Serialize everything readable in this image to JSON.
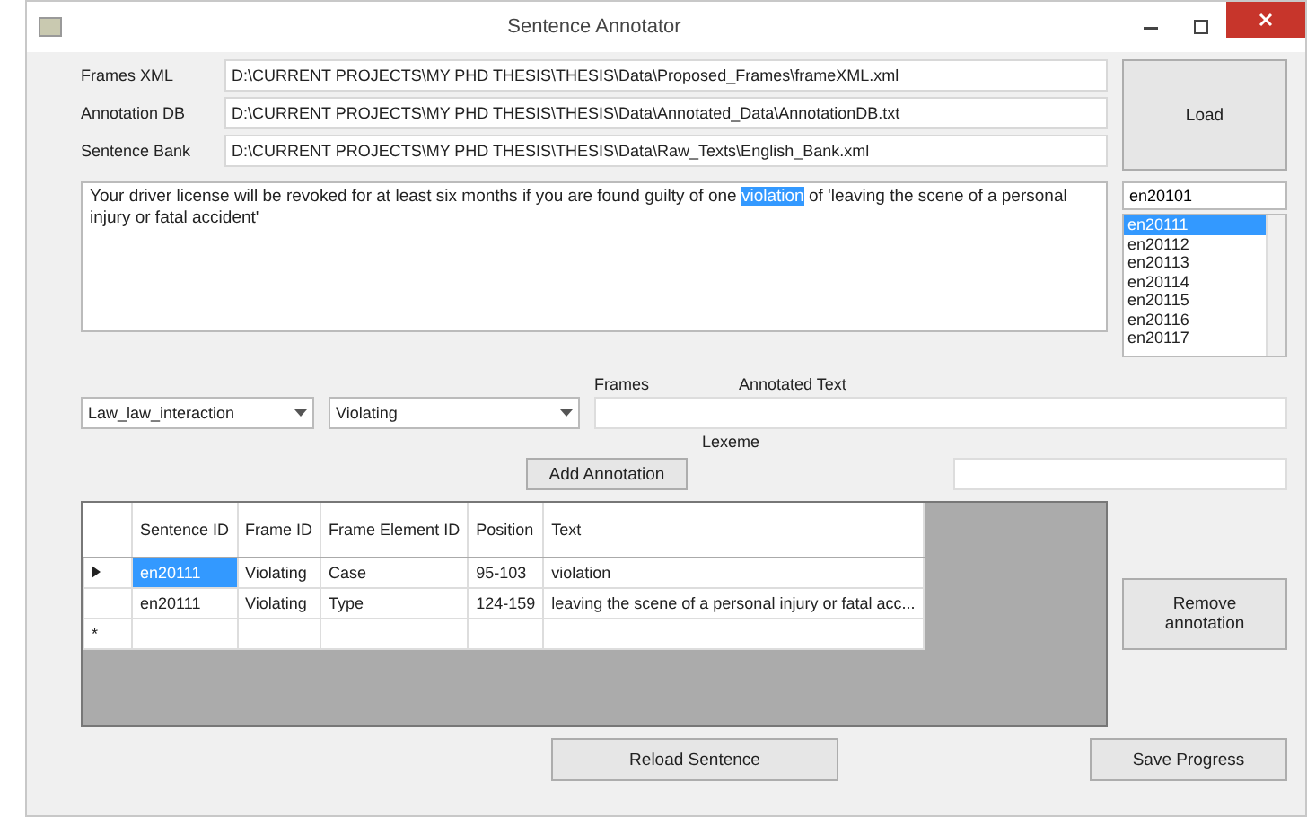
{
  "window": {
    "title": "Sentence Annotator"
  },
  "paths": [
    {
      "label": "Frames XML",
      "value": "D:\\CURRENT PROJECTS\\MY PHD THESIS\\THESIS\\Data\\Proposed_Frames\\frameXML.xml"
    },
    {
      "label": "Annotation DB",
      "value": "D:\\CURRENT PROJECTS\\MY PHD THESIS\\THESIS\\Data\\Annotated_Data\\AnnotationDB.txt"
    },
    {
      "label": "Sentence Bank",
      "value": "D:\\CURRENT PROJECTS\\MY PHD THESIS\\THESIS\\Data\\Raw_Texts\\English_Bank.xml"
    }
  ],
  "load_button": "Load",
  "sentence": [
    {
      "text": "Your driver license will be revoked for at least six months if you are found guilty of one ",
      "selected": false
    },
    {
      "text": "violation",
      "selected": true
    },
    {
      "text": " of 'leaving the scene of a personal injury or fatal accident'",
      "selected": false
    }
  ],
  "sentence_search": {
    "value": "en20101"
  },
  "sentence_list": [
    {
      "label": "en20111",
      "selected": true
    },
    {
      "label": "en20112",
      "selected": false
    },
    {
      "label": "en20113",
      "selected": false
    },
    {
      "label": "en20114",
      "selected": false
    },
    {
      "label": "en20115",
      "selected": false
    },
    {
      "label": "en20116",
      "selected": false
    },
    {
      "label": "en20117",
      "selected": false
    }
  ],
  "frame_combo": {
    "value": "Law_law_interaction"
  },
  "element_combo": {
    "value": "Violating"
  },
  "frames_label": "Frames",
  "annotated_text": {
    "label": "Annotated Text"
  },
  "lexeme": {
    "label": "Lexeme"
  },
  "add_button": "Add Annotation",
  "table": {
    "columns": [
      "Sentence ID",
      "Frame ID",
      "Frame Element ID",
      "Position",
      "Text"
    ],
    "rows": [
      {
        "selected": true,
        "cells": [
          "en20111",
          "Violating",
          "Case",
          "95-103",
          "violation"
        ]
      },
      {
        "selected": false,
        "cells": [
          "en20111",
          "Violating",
          "Type",
          "124-159",
          "leaving the scene of a personal injury or fatal acc..."
        ]
      }
    ],
    "new_row_marker": "*"
  },
  "remove_button": "Remove annotation",
  "reload_button": "Reload Sentence",
  "save_button": "Save Progress"
}
